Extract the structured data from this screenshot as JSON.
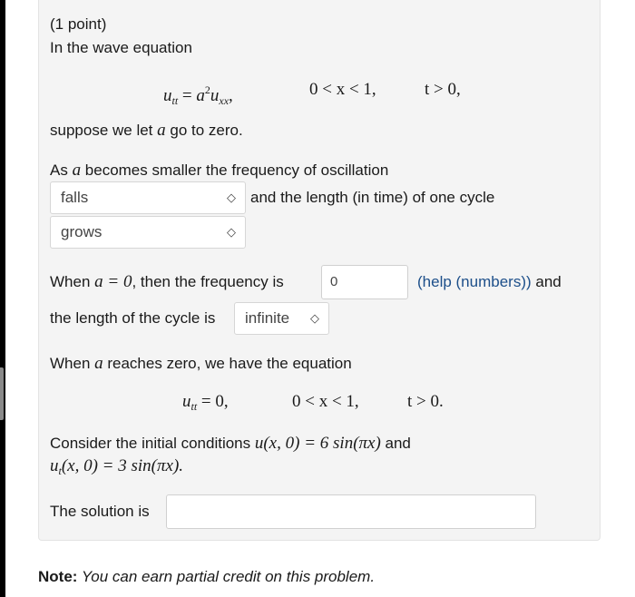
{
  "problem": {
    "points": "(1 point)",
    "intro": "In the wave equation",
    "eq1": {
      "lhs_u": "u",
      "lhs_sub": "tt",
      "equals": "=",
      "a": "a",
      "sup": "2",
      "u": "u",
      "sub": "xx",
      "comma": ",",
      "domain": "0 < x < 1,",
      "time": "t > 0,"
    },
    "suppose_pre": "suppose we let ",
    "suppose_var": "a",
    "suppose_post": " go to zero.",
    "as_pre": "As ",
    "as_var": "a",
    "as_post": " becomes smaller the frequency of oscillation",
    "select1": {
      "value": "falls",
      "icon": "⇕"
    },
    "and_length": "and the length (in time) of one cycle",
    "select2": {
      "value": "grows",
      "icon": "⇕"
    },
    "when_pre": "When ",
    "when_math": "a = 0",
    "when_post": ", then the frequency is",
    "frequency_input": {
      "value": "0"
    },
    "help_link": "(help (numbers))",
    "help_and": " and",
    "cycle_label": "the length of the cycle is",
    "select3": {
      "value": "infinite",
      "icon": "⇕"
    },
    "reach_pre": "When ",
    "reach_var": "a",
    "reach_post": " reaches zero, we have the equation",
    "eq2": {
      "lhs_u": "u",
      "lhs_sub": "tt",
      "rhs": "= 0,",
      "domain": "0 < x < 1,",
      "time": "t > 0."
    },
    "consider_pre": "Consider the initial conditions ",
    "ic1": "u(x, 0) = 6 sin(πx)",
    "consider_and": " and",
    "ic2_u": "u",
    "ic2_sub": "t",
    "ic2_rest": "(x, 0) = 3 sin(πx).",
    "solution_label": "The solution is",
    "solution_input": {
      "value": ""
    }
  },
  "note": {
    "label": "Note:",
    "text": " You can earn partial credit on this problem."
  }
}
